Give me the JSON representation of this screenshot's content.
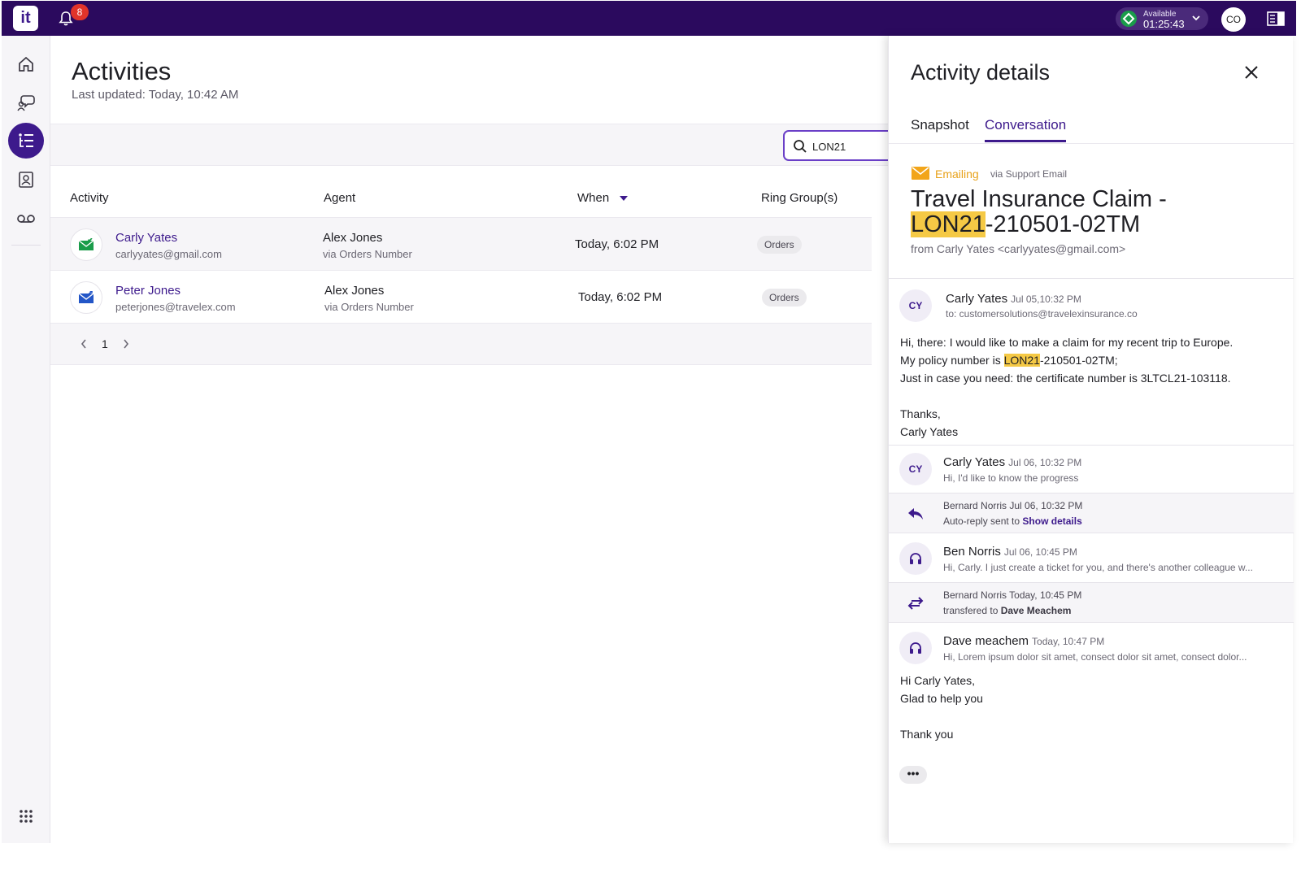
{
  "topbar": {
    "logo_text": "it",
    "notifications_count": "8",
    "status_label": "Available",
    "status_time": "01:25:43",
    "user_initials": "CO"
  },
  "sidebar": {
    "items": [
      {
        "icon": "home-icon"
      },
      {
        "icon": "conversations-icon"
      },
      {
        "icon": "activities-icon",
        "active": true
      },
      {
        "icon": "contacts-icon"
      },
      {
        "icon": "voicemail-icon"
      }
    ],
    "apps_icon": "apps-grid-icon"
  },
  "page": {
    "title": "Activities",
    "last_updated": "Last updated: Today, 10:42 AM"
  },
  "search": {
    "value": "LON21"
  },
  "table": {
    "columns": [
      "Activity",
      "Agent",
      "When",
      "Ring Group(s)"
    ],
    "rows": [
      {
        "name": "Carly Yates",
        "email": "carlyyates@gmail.com",
        "agent": "Alex Jones",
        "agent_via": "via Orders Number",
        "when": "Today, 6:02 PM",
        "ring_group": "Orders",
        "direction": "incoming"
      },
      {
        "name": "Peter Jones",
        "email": "peterjones@travelex.com",
        "agent": "Alex Jones",
        "agent_via": "via Orders Number",
        "when": "Today, 6:02 PM",
        "ring_group": "Orders",
        "direction": "outgoing"
      }
    ],
    "page": "1"
  },
  "details": {
    "title": "Activity details",
    "tabs": [
      "Snapshot",
      "Conversation"
    ],
    "active_tab": "Conversation",
    "channel": "Emailing",
    "channel_via": "via Support Email",
    "subject_prefix": "Travel Insurance Claim -",
    "subject_highlight": "LON21",
    "subject_suffix": "-210501-02TM",
    "from": "from Carly Yates <carlyyates@gmail.com>",
    "messages": [
      {
        "initials": "CY",
        "author": "Carly Yates",
        "time": "Jul 05,10:32 PM",
        "to": "to: customersolutions@travelexinsurance.co",
        "body_line1": "Hi, there: I would like to make a claim for my recent trip to Europe.",
        "body_line2_prefix": "My policy number is ",
        "body_line2_highlight": "LON21",
        "body_line2_suffix": "-210501-02TM;",
        "body_line3": "Just in case you need: the certificate number is 3LTCL21-103118.",
        "body_line4": "Thanks,",
        "body_line5": "Carly Yates"
      },
      {
        "initials": "CY",
        "author": "Carly Yates",
        "time": "Jul 06, 10:32 PM",
        "preview": "Hi, I'd like to know the progress"
      },
      {
        "author": "Bernard Norris",
        "time": "Jul 06, 10:32 PM",
        "text_prefix": "Auto-reply sent to",
        "link": "Show details"
      },
      {
        "author": "Ben Norris",
        "time": "Jul 06, 10:45 PM",
        "preview": "Hi, Carly. I just create a ticket for you, and there's another colleague w..."
      },
      {
        "author": "Bernard Norris",
        "time": "Today, 10:45 PM",
        "text_prefix": "transfered to",
        "target": "Dave Meachem"
      },
      {
        "author": "Dave meachem",
        "time": "Today, 10:47 PM",
        "preview": "Hi, Lorem ipsum dolor sit amet, consect dolor sit amet, consect dolor...",
        "body_line1": "Hi Carly Yates,",
        "body_line2": "Glad to help you",
        "body_line3": "Thank you"
      }
    ],
    "more_label": "•••"
  },
  "colors": {
    "brand": "#2b0a5e",
    "accent": "#3d1a8c",
    "highlight": "#f5c945",
    "email_accent": "#e8a21a",
    "status_green": "#1a9c4a"
  }
}
